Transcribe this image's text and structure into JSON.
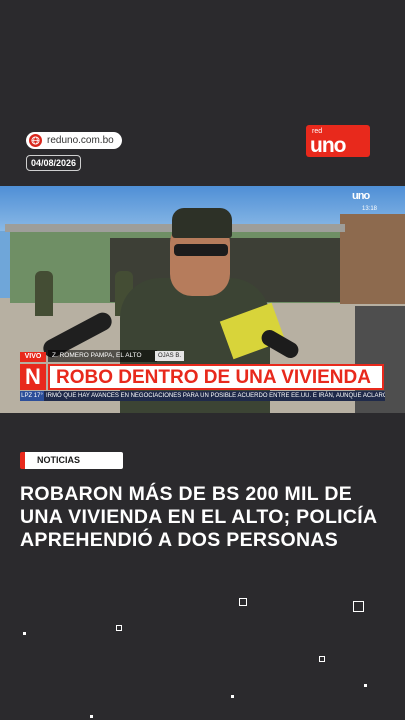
{
  "source": {
    "site": "reduno.com.bo",
    "icon": "globe-icon"
  },
  "date": "04/08/2026",
  "brand": {
    "top": "red",
    "name": "uno"
  },
  "broadcast": {
    "channel_logo": "uno",
    "time": "13:18",
    "live_tag": "VIVO",
    "location": "Z. ROMERO PAMPA, EL ALTO",
    "location_extra": "OJAS B.",
    "channel_letter": "N",
    "headline": "ROBO DENTRO DE UNA VIVIENDA",
    "ticker_tag": "LPZ 17°",
    "ticker_text": "IRMÓ QUE HAY AVANCES EN NEGOCIACIONES PARA UN POSIBLE ACUERDO ENTRE EE.UU. E IRÁN, AUNQUE ACLARÓ QUE NO EX"
  },
  "category": "NOTICIAS",
  "title": "ROBARON MÁS DE BS 200 MIL DE UNA VIVIENDA EN EL ALTO; POLICÍA APREHENDIÓ A DOS PERSONAS",
  "colors": {
    "accent": "#e8291c",
    "background": "#2b2a2d"
  }
}
